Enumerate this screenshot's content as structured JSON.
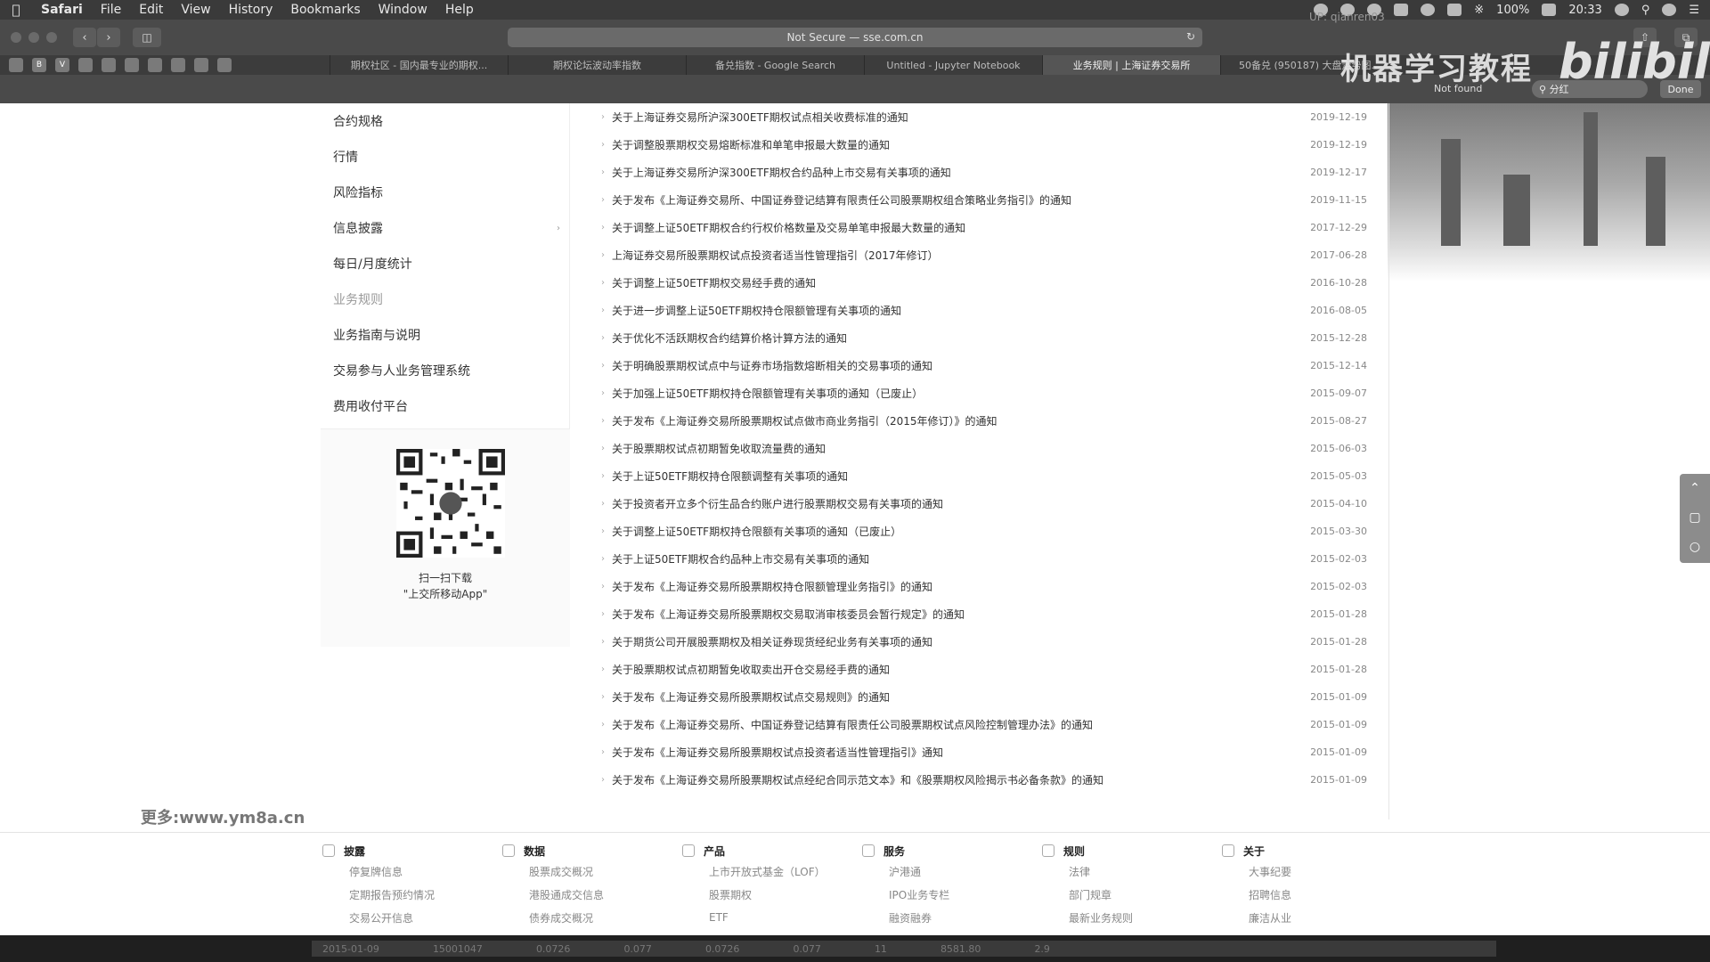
{
  "menubar": {
    "app": "Safari",
    "items": [
      "File",
      "Edit",
      "View",
      "History",
      "Bookmarks",
      "Window",
      "Help"
    ],
    "battery": "100%",
    "clock": "20:33"
  },
  "toolbar": {
    "address": "Not Secure — sse.com.cn"
  },
  "tabs": [
    {
      "label": "期权社区 - 国内最专业的期权..."
    },
    {
      "label": "期权论坛波动率指数"
    },
    {
      "label": "备兑指数 - Google Search"
    },
    {
      "label": "Untitled - Jupyter Notebook"
    },
    {
      "label": "业务规则 | 上海证券交易所"
    },
    {
      "label": "50备兑 (950187) 大盘走势图..."
    }
  ],
  "findbar": {
    "status": "Not found",
    "query": "分红",
    "done": "Done"
  },
  "overlay": {
    "watermark": "机器学习教程",
    "bilibili": "bilibili",
    "user": "UP: qianren03",
    "site": "更多:www.ym8a.cn"
  },
  "sidebar": {
    "items": [
      {
        "label": "合约规格"
      },
      {
        "label": "行情"
      },
      {
        "label": "风险指标"
      },
      {
        "label": "信息披露",
        "chevron": "›"
      },
      {
        "label": "每日/月度统计"
      },
      {
        "label": "业务规则"
      },
      {
        "label": "业务指南与说明"
      },
      {
        "label": "交易参与人业务管理系统"
      },
      {
        "label": "费用收付平台"
      }
    ],
    "qr_line1": "扫一扫下载",
    "qr_line2": "\"上交所移动App\""
  },
  "notices": [
    {
      "title": "关于上海证券交易所沪深300ETF期权试点相关收费标准的通知",
      "date": "2019-12-19"
    },
    {
      "title": "关于调整股票期权交易熔断标准和单笔申报最大数量的通知",
      "date": "2019-12-19"
    },
    {
      "title": "关于上海证券交易所沪深300ETF期权合约品种上市交易有关事项的通知",
      "date": "2019-12-17"
    },
    {
      "title": "关于发布《上海证券交易所、中国证券登记结算有限责任公司股票期权组合策略业务指引》的通知",
      "date": "2019-11-15"
    },
    {
      "title": "关于调整上证50ETF期权合约行权价格数量及交易单笔申报最大数量的通知",
      "date": "2017-12-29"
    },
    {
      "title": "上海证券交易所股票期权试点投资者适当性管理指引（2017年修订）",
      "date": "2017-06-28"
    },
    {
      "title": "关于调整上证50ETF期权交易经手费的通知",
      "date": "2016-10-28"
    },
    {
      "title": "关于进一步调整上证50ETF期权持仓限额管理有关事项的通知",
      "date": "2016-08-05"
    },
    {
      "title": "关于优化不活跃期权合约结算价格计算方法的通知",
      "date": "2015-12-28"
    },
    {
      "title": "关于明确股票期权试点中与证券市场指数熔断相关的交易事项的通知",
      "date": "2015-12-14"
    },
    {
      "title": "关于加强上证50ETF期权持仓限额管理有关事项的通知（已废止）",
      "date": "2015-09-07"
    },
    {
      "title": "关于发布《上海证券交易所股票期权试点做市商业务指引（2015年修订）》的通知",
      "date": "2015-08-27"
    },
    {
      "title": "关于股票期权试点初期暂免收取流量费的通知",
      "date": "2015-06-03"
    },
    {
      "title": "关于上证50ETF期权持仓限额调整有关事项的通知",
      "date": "2015-05-03"
    },
    {
      "title": "关于投资者开立多个衍生品合约账户进行股票期权交易有关事项的通知",
      "date": "2015-04-10"
    },
    {
      "title": "关于调整上证50ETF期权持仓限额有关事项的通知（已废止）",
      "date": "2015-03-30"
    },
    {
      "title": "关于上证50ETF期权合约品种上市交易有关事项的通知",
      "date": "2015-02-03"
    },
    {
      "title": "关于发布《上海证券交易所股票期权持仓限额管理业务指引》的通知",
      "date": "2015-02-03"
    },
    {
      "title": "关于发布《上海证券交易所股票期权交易取消审核委员会暂行规定》的通知",
      "date": "2015-01-28"
    },
    {
      "title": "关于期货公司开展股票期权及相关证券现货经纪业务有关事项的通知",
      "date": "2015-01-28"
    },
    {
      "title": "关于股票期权试点初期暂免收取卖出开仓交易经手费的通知",
      "date": "2015-01-28"
    },
    {
      "title": "关于发布《上海证券交易所股票期权试点交易规则》的通知",
      "date": "2015-01-09"
    },
    {
      "title": "关于发布《上海证券交易所、中国证券登记结算有限责任公司股票期权试点风险控制管理办法》的通知",
      "date": "2015-01-09"
    },
    {
      "title": "关于发布《上海证券交易所股票期权试点投资者适当性管理指引》通知",
      "date": "2015-01-09"
    },
    {
      "title": "关于发布《上海证券交易所股票期权试点经纪合同示范文本》和《股票期权风险揭示书必备条款》的通知",
      "date": "2015-01-09"
    }
  ],
  "footer": [
    {
      "head": "披露",
      "icon": "disclosure-icon",
      "links": [
        "停复牌信息",
        "定期报告预约情况",
        "交易公开信息"
      ]
    },
    {
      "head": "数据",
      "icon": "chart-line-icon",
      "links": [
        "股票成交概况",
        "港股通成交信息",
        "债券成交概况"
      ]
    },
    {
      "head": "产品",
      "icon": "bar-chart-icon",
      "links": [
        "上市开放式基金（LOF）",
        "股票期权",
        "ETF"
      ]
    },
    {
      "head": "服务",
      "icon": "service-icon",
      "links": [
        "沪港通",
        "IPO业务专栏",
        "融资融券"
      ]
    },
    {
      "head": "规则",
      "icon": "rule-icon",
      "links": [
        "法律",
        "部门规章",
        "最新业务规则"
      ]
    },
    {
      "head": "关于",
      "icon": "book-icon",
      "links": [
        "大事纪要",
        "招聘信息",
        "廉洁从业"
      ]
    }
  ],
  "bottom_bar": [
    "2015-01-09",
    "15001047",
    "0.0726",
    "0.077",
    "0.0726",
    "0.077",
    "11",
    "8581.80",
    "2.9"
  ]
}
